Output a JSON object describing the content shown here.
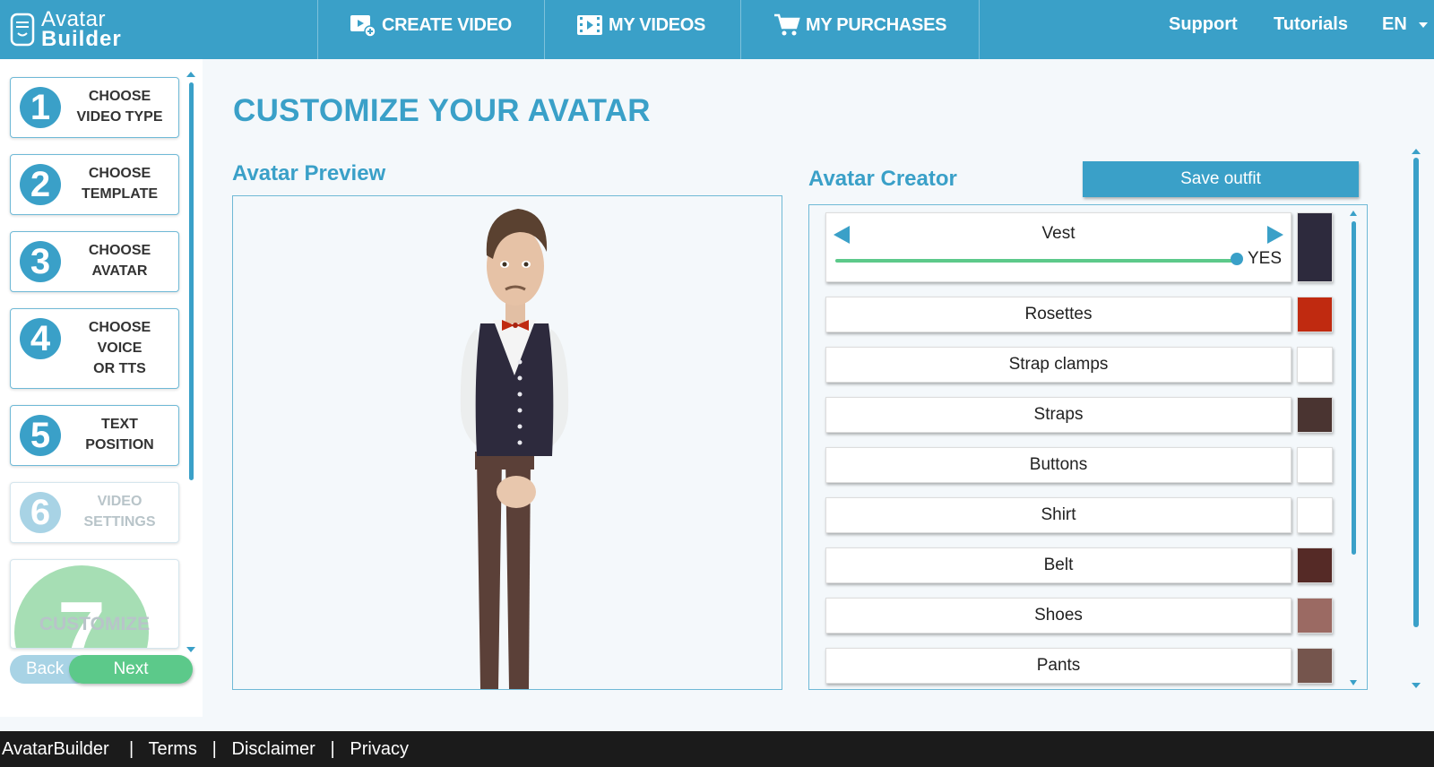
{
  "logo": {
    "line1": "Avatar",
    "line2": "Builder"
  },
  "nav": {
    "create_video": "CREATE VIDEO",
    "my_videos": "MY VIDEOS",
    "my_purchases": "MY PURCHASES",
    "support": "Support",
    "tutorials": "Tutorials",
    "language": "EN"
  },
  "steps": [
    {
      "number": "1",
      "label_lines": [
        "CHOOSE",
        "VIDEO TYPE"
      ]
    },
    {
      "number": "2",
      "label_lines": [
        "CHOOSE",
        "TEMPLATE"
      ]
    },
    {
      "number": "3",
      "label_lines": [
        "CHOOSE",
        "AVATAR"
      ]
    },
    {
      "number": "4",
      "label_lines": [
        "CHOOSE",
        "VOICE",
        "OR TTS"
      ]
    },
    {
      "number": "5",
      "label_lines": [
        "TEXT",
        "POSITION"
      ]
    },
    {
      "number": "6",
      "label_lines": [
        "VIDEO",
        "SETTINGS"
      ]
    },
    {
      "number": "7",
      "label_lines": [
        "CUSTOMIZE"
      ]
    }
  ],
  "wizard": {
    "back": "Back",
    "next": "Next"
  },
  "page_title": "CUSTOMIZE YOUR AVATAR",
  "preview": {
    "heading": "Avatar Preview"
  },
  "creator": {
    "heading": "Avatar Creator",
    "save_button": "Save outfit",
    "vest": {
      "label": "Vest",
      "toggle_value": "YES",
      "slider_fraction": 1.0,
      "color": "#2d2a3d"
    },
    "parts": [
      {
        "label": "Rosettes",
        "color": "#c02a10"
      },
      {
        "label": "Strap clamps",
        "color": "#ffffff"
      },
      {
        "label": "Straps",
        "color": "#4a3431"
      },
      {
        "label": "Buttons",
        "color": "#ffffff"
      },
      {
        "label": "Shirt",
        "color": "#ffffff"
      },
      {
        "label": "Belt",
        "color": "#552a26"
      },
      {
        "label": "Shoes",
        "color": "#9b6a63"
      },
      {
        "label": "Pants",
        "color": "#75554d"
      }
    ]
  },
  "footer": {
    "brand": "AvatarBuilder",
    "terms": "Terms",
    "disclaimer": "Disclaimer",
    "privacy": "Privacy",
    "separator": "|"
  },
  "colors": {
    "accent": "#3aa0c8",
    "next_green": "#5cc98a",
    "footer_bg": "#1b1b1b"
  }
}
